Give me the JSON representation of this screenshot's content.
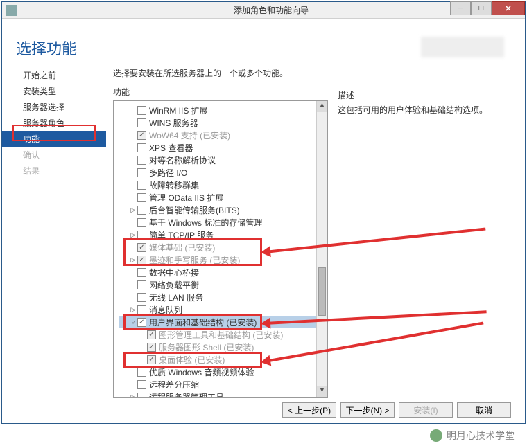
{
  "window": {
    "title": "添加角色和功能向导"
  },
  "heading": "选择功能",
  "nav": {
    "items": [
      {
        "label": "开始之前",
        "active": false,
        "dim": false
      },
      {
        "label": "安装类型",
        "active": false,
        "dim": false
      },
      {
        "label": "服务器选择",
        "active": false,
        "dim": false
      },
      {
        "label": "服务器角色",
        "active": false,
        "dim": false
      },
      {
        "label": "功能",
        "active": true,
        "dim": false
      },
      {
        "label": "确认",
        "active": false,
        "dim": true
      },
      {
        "label": "结果",
        "active": false,
        "dim": true
      }
    ]
  },
  "intro_text": "选择要安装在所选服务器上的一个或多个功能。",
  "col_titles": {
    "left": "功能",
    "right": "描述"
  },
  "tree": [
    {
      "indent": 1,
      "chev": "",
      "checked": false,
      "disabled": false,
      "label": "WinRM IIS 扩展"
    },
    {
      "indent": 1,
      "chev": "",
      "checked": false,
      "disabled": false,
      "label": "WINS 服务器"
    },
    {
      "indent": 1,
      "chev": "",
      "checked": true,
      "disabled": true,
      "label": "WoW64 支持 (已安装)"
    },
    {
      "indent": 1,
      "chev": "",
      "checked": false,
      "disabled": false,
      "label": "XPS 查看器"
    },
    {
      "indent": 1,
      "chev": "",
      "checked": false,
      "disabled": false,
      "label": "对等名称解析协议"
    },
    {
      "indent": 1,
      "chev": "",
      "checked": false,
      "disabled": false,
      "label": "多路径 I/O"
    },
    {
      "indent": 1,
      "chev": "",
      "checked": false,
      "disabled": false,
      "label": "故障转移群集"
    },
    {
      "indent": 1,
      "chev": "",
      "checked": false,
      "disabled": false,
      "label": "管理 OData IIS 扩展"
    },
    {
      "indent": 1,
      "chev": "▷",
      "checked": false,
      "disabled": false,
      "label": "后台智能传输服务(BITS)"
    },
    {
      "indent": 1,
      "chev": "",
      "checked": false,
      "disabled": false,
      "label": "基于 Windows 标准的存储管理"
    },
    {
      "indent": 1,
      "chev": "▷",
      "checked": false,
      "disabled": false,
      "label": "简单 TCP/IP 服务"
    },
    {
      "indent": 1,
      "chev": "",
      "checked": true,
      "disabled": true,
      "label": "媒体基础 (已安装)"
    },
    {
      "indent": 1,
      "chev": "▷",
      "checked": true,
      "disabled": true,
      "label": "墨迹和手写服务 (已安装)"
    },
    {
      "indent": 1,
      "chev": "",
      "checked": false,
      "disabled": false,
      "label": "数据中心桥接"
    },
    {
      "indent": 1,
      "chev": "",
      "checked": false,
      "disabled": false,
      "label": "网络负载平衡"
    },
    {
      "indent": 1,
      "chev": "",
      "checked": false,
      "disabled": false,
      "label": "无线 LAN 服务"
    },
    {
      "indent": 1,
      "chev": "▷",
      "checked": false,
      "disabled": false,
      "label": "消息队列"
    },
    {
      "indent": 1,
      "chev": "▿",
      "checked": true,
      "disabled": false,
      "label": "用户界面和基础结构 (已安装)",
      "selected": true
    },
    {
      "indent": 2,
      "chev": "",
      "checked": true,
      "disabled": true,
      "label": "图形管理工具和基础结构 (已安装)"
    },
    {
      "indent": 2,
      "chev": "",
      "checked": true,
      "disabled": true,
      "label": "服务器图形 Shell (已安装)"
    },
    {
      "indent": 2,
      "chev": "",
      "checked": true,
      "disabled": true,
      "label": "桌面体验 (已安装)"
    },
    {
      "indent": 1,
      "chev": "",
      "checked": false,
      "disabled": false,
      "label": "优质 Windows 音频视频体验"
    },
    {
      "indent": 1,
      "chev": "",
      "checked": false,
      "disabled": false,
      "label": "远程差分压缩"
    },
    {
      "indent": 1,
      "chev": "▷",
      "checked": false,
      "disabled": false,
      "label": "远程服务器管理工具"
    }
  ],
  "description": "这包括可用的用户体验和基础结构选项。",
  "buttons": {
    "prev": "< 上一步(P)",
    "next": "下一步(N) >",
    "install": "安装(I)",
    "cancel": "取消"
  },
  "watermark": "明月心技术学堂"
}
